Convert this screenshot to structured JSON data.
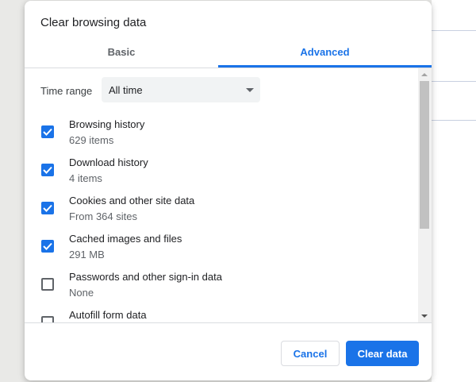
{
  "dialog": {
    "title": "Clear browsing data"
  },
  "tabs": [
    {
      "label": "Basic",
      "active": false
    },
    {
      "label": "Advanced",
      "active": true
    }
  ],
  "time_range": {
    "label": "Time range",
    "value": "All time"
  },
  "items": [
    {
      "title": "Browsing history",
      "subtitle": "629 items",
      "checked": true
    },
    {
      "title": "Download history",
      "subtitle": "4 items",
      "checked": true
    },
    {
      "title": "Cookies and other site data",
      "subtitle": "From 364 sites",
      "checked": true
    },
    {
      "title": "Cached images and files",
      "subtitle": "291 MB",
      "checked": true
    },
    {
      "title": "Passwords and other sign-in data",
      "subtitle": "None",
      "checked": false
    },
    {
      "title": "Autofill form data",
      "subtitle": "",
      "checked": false
    }
  ],
  "buttons": {
    "cancel": "Cancel",
    "clear": "Clear data"
  },
  "colors": {
    "accent": "#1a73e8",
    "text": "#202124",
    "secondary_text": "#5f6368"
  },
  "icons": {
    "checkmark": "check-icon",
    "dropdown": "chevron-down-icon"
  }
}
